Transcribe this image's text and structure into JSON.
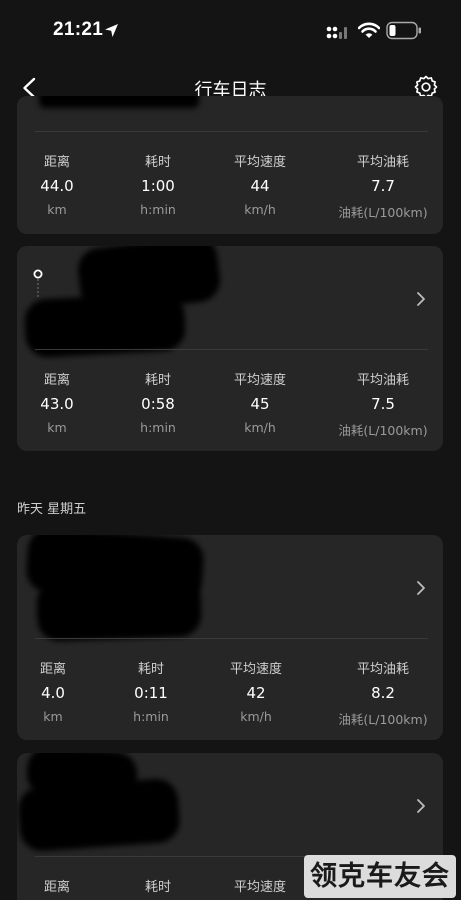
{
  "status_bar": {
    "time": "21:21"
  },
  "nav": {
    "title": "行车日志"
  },
  "labels": {
    "distance": "距离",
    "duration": "耗时",
    "avg_speed": "平均速度",
    "avg_fuel": "平均油耗"
  },
  "units": {
    "distance": "km",
    "duration": "h:min",
    "speed": "km/h",
    "fuel": "油耗(L/100km)"
  },
  "trips": [
    {
      "distance": "44.0",
      "duration": "1:00",
      "avg_speed": "44",
      "avg_fuel": "7.7"
    },
    {
      "distance": "43.0",
      "duration": "0:58",
      "avg_speed": "45",
      "avg_fuel": "7.5"
    },
    {
      "distance": "4.0",
      "duration": "0:11",
      "avg_speed": "42",
      "avg_fuel": "8.2"
    }
  ],
  "section_yesterday": "昨天 星期五",
  "watermark": "领克车友会",
  "icons": [
    "location-arrow-icon",
    "signal-icon",
    "wifi-icon",
    "battery-icon",
    "back-arrow-icon",
    "gear-icon",
    "chevron-right-icon"
  ],
  "colors": {
    "background": "#141414",
    "card": "#262626",
    "divider": "#3a3a3a"
  }
}
